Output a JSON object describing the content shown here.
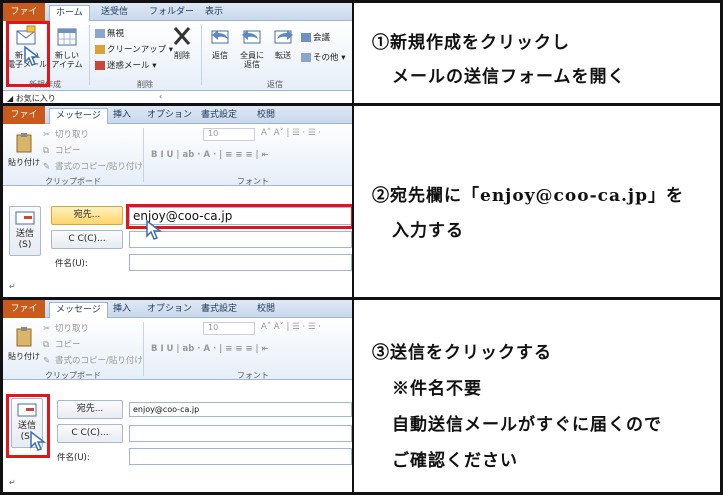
{
  "panel1": {
    "tabs": [
      "ファイル",
      "ホーム",
      "送受信",
      "フォルダー",
      "表示"
    ],
    "new_mail_line1": "新しい",
    "new_mail_line2": "電子メール",
    "new_items_line1": "新しい",
    "new_items_line2": "アイテム",
    "group_new": "新規作成",
    "ignore": "無視",
    "cleanup": "クリーンアップ",
    "junk": "迷惑メール",
    "delete": "削除",
    "group_delete": "削除",
    "reply": "返信",
    "reply_all_line1": "全員に",
    "reply_all_line2": "返信",
    "forward": "転送",
    "meeting": "会議",
    "more": "その他",
    "group_respond": "返信",
    "favorites": "お気に入り"
  },
  "compose": {
    "tabs": [
      "ファイル",
      "メッセージ",
      "挿入",
      "オプション",
      "書式設定",
      "校閲"
    ],
    "cut": "切り取り",
    "copy": "コピー",
    "paste_line1": "貼り付け",
    "format_painter": "書式のコピー/貼り付け",
    "group_clipboard": "クリップボード",
    "group_font": "フォント",
    "font_size": "10",
    "send_line1": "送信",
    "send_line2": "(S)",
    "to_button": "宛先...",
    "cc_button": "C C(C)...",
    "subject_label": "件名(U):",
    "to_value": "enjoy@coo-ca.jp",
    "paragraph_mark": "↵"
  },
  "steps": [
    {
      "line1": "①新規作成をクリックし",
      "line2": "メールの送信フォームを開く"
    },
    {
      "line1": "②宛先欄に「enjoy@coo-ca.jp」を",
      "line2": "入力する"
    },
    {
      "line1": "③送信をクリックする",
      "line2": "※件名不要",
      "line3": "自動送信メールがすぐに届くので",
      "line4": "ご確認ください"
    }
  ],
  "colors": {
    "file_tab": "#c85a1b",
    "highlight_box": "#e0161d",
    "ribbon": "#e6eef8"
  }
}
